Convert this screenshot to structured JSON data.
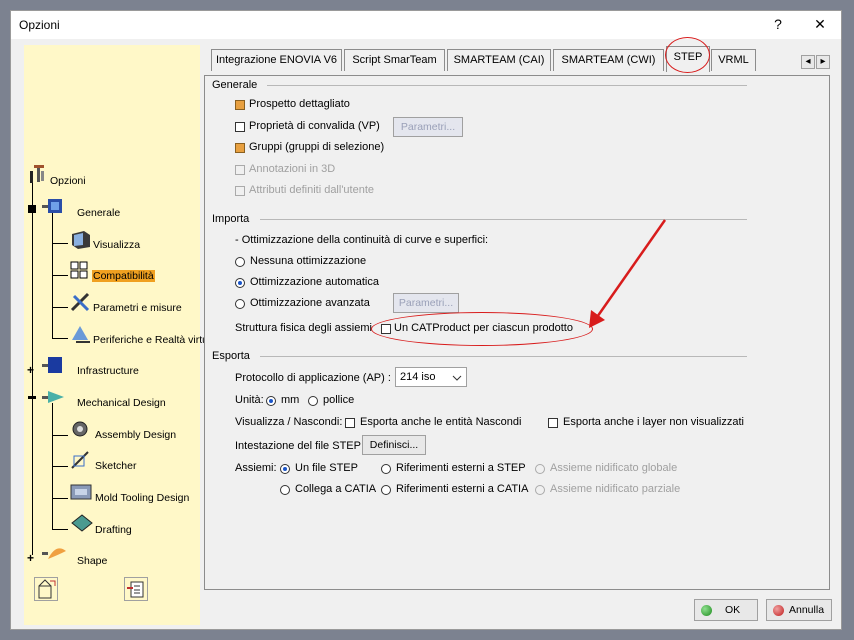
{
  "window": {
    "title": "Opzioni",
    "help": "?",
    "close": "✕"
  },
  "tree": {
    "root": "Opzioni",
    "items": [
      {
        "label": "Generale"
      },
      {
        "label": "Visualizza"
      },
      {
        "label": "Compatibilità"
      },
      {
        "label": "Parametri e misure"
      },
      {
        "label": "Periferiche e Realtà virtu"
      },
      {
        "label": "Infrastructure"
      },
      {
        "label": "Mechanical Design"
      },
      {
        "label": "Assembly Design"
      },
      {
        "label": "Sketcher"
      },
      {
        "label": "Mold Tooling Design"
      },
      {
        "label": "Drafting"
      },
      {
        "label": "Shape"
      }
    ]
  },
  "tabs": [
    "Integrazione ENOVIA V6",
    "Script SmarTeam",
    "SMARTEAM (CAI)",
    "SMARTEAM (CWI)",
    "STEP",
    "VRML"
  ],
  "tab_scroll": {
    "left": "◂",
    "right": "▸"
  },
  "generale": {
    "title": "Generale",
    "prospetto": "Prospetto dettagliato",
    "proprieta": "Proprietà di convalida (VP)",
    "parametri_btn": "Parametri...",
    "gruppi": "Gruppi (gruppi di selezione)",
    "annotazioni": "Annotazioni in 3D",
    "attributi": "Attributi definiti dall'utente"
  },
  "importa": {
    "title": "Importa",
    "ottimizzazione_label": "- Ottimizzazione della continuità di curve e superfici:",
    "nessuna": "Nessuna ottimizzazione",
    "automatica": "Ottimizzazione automatica",
    "avanzata": "Ottimizzazione avanzata",
    "parametri_btn": "Parametri...",
    "struttura_label": "Struttura fisica degli assiemi",
    "catproduct": "Un CATProduct per ciascun prodotto"
  },
  "esporta": {
    "title": "Esporta",
    "protocollo_label": "Protocollo di applicazione (AP) :",
    "protocollo_value": "214 iso",
    "unita_label": "Unità:",
    "mm": "mm",
    "pollice": "pollice",
    "visualizza_label": "Visualizza / Nascondi:",
    "esporta_nascondi": "Esporta anche le entità Nascondi",
    "esporta_layer": "Esporta anche i layer non visualizzati",
    "intestazione_label": "Intestazione del file STEP:",
    "definisci_btn": "Definisci...",
    "assiemi_label": "Assiemi:",
    "un_file": "Un file STEP",
    "rif_step": "Riferimenti esterni a STEP",
    "nidificato_globale": "Assieme nidificato globale",
    "collega": "Collega a CATIA",
    "rif_catia": "Riferimenti esterni a CATIA",
    "nidificato_parziale": "Assieme nidificato parziale"
  },
  "footer": {
    "ok": "OK",
    "annulla": "Annulla"
  },
  "colors": {
    "tree_bg": "#fff8c8",
    "annotation_red": "#d81c1c",
    "selected": "#f0a020"
  }
}
